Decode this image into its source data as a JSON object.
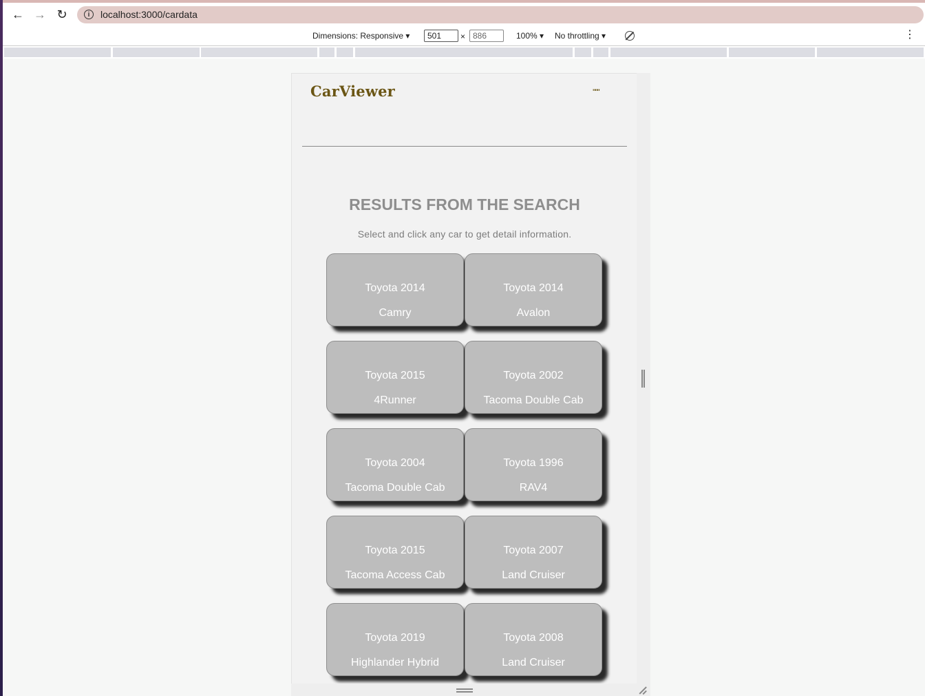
{
  "browser": {
    "url": "localhost:3000/cardata"
  },
  "devtools": {
    "dimensions_label": "Dimensions: Responsive ▾",
    "width": "501",
    "times": "×",
    "height": "886",
    "zoom": "100% ▾",
    "throttling": "No throttling ▾"
  },
  "app": {
    "logo": "CarViewer",
    "menu_glyph": "\"\"\"",
    "heading": "RESULTS FROM THE SEARCH",
    "subtitle": "Select and click any car to get detail information.",
    "cars": [
      {
        "title": "Toyota 2014",
        "model": "Camry"
      },
      {
        "title": "Toyota 2014",
        "model": "Avalon"
      },
      {
        "title": "Toyota 2015",
        "model": "4Runner"
      },
      {
        "title": "Toyota 2002",
        "model": "Tacoma Double Cab"
      },
      {
        "title": "Toyota 2004",
        "model": "Tacoma Double Cab"
      },
      {
        "title": "Toyota 1996",
        "model": "RAV4"
      },
      {
        "title": "Toyota 2015",
        "model": "Tacoma Access Cab"
      },
      {
        "title": "Toyota 2007",
        "model": "Land Cruiser"
      },
      {
        "title": "Toyota 2019",
        "model": "Highlander Hybrid"
      },
      {
        "title": "Toyota 2008",
        "model": "Land Cruiser"
      }
    ]
  },
  "colors": {
    "logo": "#6b5615",
    "card_bg": "#bdbdbd",
    "heading": "#8e8e8e",
    "url_pill": "#e2cbc8"
  }
}
